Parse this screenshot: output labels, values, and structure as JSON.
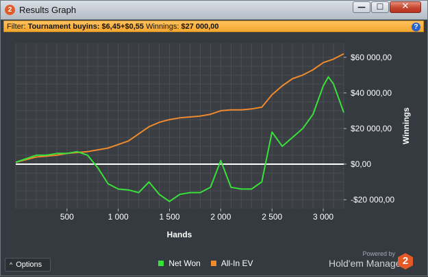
{
  "window": {
    "title": "Results Graph",
    "app_icon": "2",
    "controls": {
      "minimize": "—",
      "maximize": "☐",
      "close": "✕"
    }
  },
  "filter": {
    "label": "Filter:",
    "key1": "Tournament buyins:",
    "value1": "$6,45+$0,55",
    "key2": "Winnings:",
    "value2": "$27 000,00",
    "help": "?"
  },
  "colors": {
    "net_won": "#39e23a",
    "allin_ev": "#f08a2c",
    "zero_line": "#ffffff",
    "filter_bg": "#f7ae38"
  },
  "chart_data": {
    "type": "line",
    "xlabel": "Hands",
    "ylabel": "Winnings",
    "xlim": [
      0,
      3200
    ],
    "ylim": [
      -25000,
      68000
    ],
    "x_ticks": [
      500,
      1000,
      1500,
      2000,
      2500,
      3000
    ],
    "x_tick_labels": [
      "500",
      "1 000",
      "1 500",
      "2 000",
      "2 500",
      "3 000"
    ],
    "y_ticks": [
      60000,
      40000,
      20000,
      0,
      -20000
    ],
    "y_tick_labels": [
      "$60 000,00",
      "$40 000,00",
      "$20 000,00",
      "$0,00",
      "-$20 000,00"
    ],
    "series": [
      {
        "name": "All-In EV",
        "color": "#f08a2c",
        "x": [
          0,
          100,
          200,
          300,
          400,
          500,
          600,
          700,
          800,
          900,
          1000,
          1100,
          1200,
          1300,
          1400,
          1500,
          1600,
          1700,
          1800,
          1900,
          2000,
          2100,
          2200,
          2300,
          2400,
          2500,
          2600,
          2700,
          2800,
          2900,
          3000,
          3100,
          3200
        ],
        "y": [
          1000,
          2500,
          4000,
          4500,
          5000,
          6000,
          6500,
          7000,
          8000,
          9000,
          11000,
          13000,
          17000,
          21000,
          23500,
          25000,
          26000,
          26500,
          27000,
          28000,
          30000,
          30500,
          30500,
          31000,
          32000,
          39000,
          44000,
          48000,
          50000,
          53000,
          57000,
          59000,
          62000
        ]
      },
      {
        "name": "Net Won",
        "color": "#39e23a",
        "x": [
          0,
          100,
          200,
          300,
          400,
          500,
          600,
          700,
          800,
          900,
          1000,
          1100,
          1200,
          1300,
          1400,
          1500,
          1600,
          1700,
          1800,
          1900,
          2000,
          2100,
          2200,
          2300,
          2400,
          2500,
          2600,
          2700,
          2800,
          2900,
          3000,
          3050,
          3100,
          3150,
          3200
        ],
        "y": [
          1000,
          3000,
          5000,
          5000,
          6000,
          6000,
          7000,
          5000,
          -2000,
          -11000,
          -14000,
          -14500,
          -16000,
          -10000,
          -17000,
          -21000,
          -17000,
          -16000,
          -16000,
          -13000,
          2000,
          -13000,
          -14000,
          -14000,
          -10000,
          18000,
          10000,
          15000,
          20000,
          28000,
          44000,
          49000,
          45000,
          37000,
          29000
        ]
      }
    ],
    "legend": [
      "Net Won",
      "All-In EV"
    ],
    "grid": true
  },
  "footer": {
    "options_label": "Options",
    "options_icon": "chevron-up-icon",
    "powered_by": "Powered by",
    "brand": "Hold'em Manager",
    "brand_logo": "2"
  }
}
